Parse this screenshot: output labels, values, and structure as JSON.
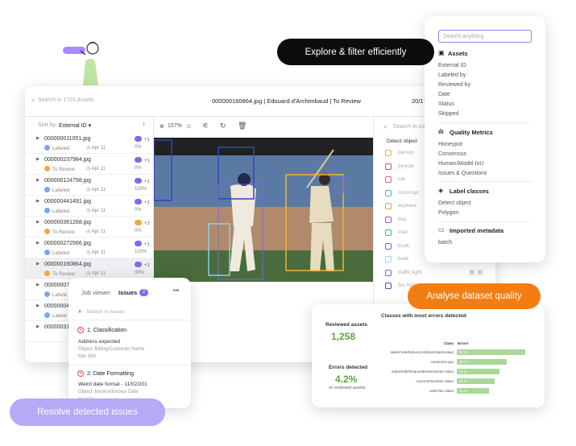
{
  "colors": {
    "accent": "#8a86f8",
    "orange": "#f27e13",
    "pill_dark": "#0d0d0d",
    "lavender": "#b7a9f5",
    "green": "#a9d897",
    "metric_green": "#5aa640"
  },
  "illustration": {
    "icon": "person-with-flag-illustration"
  },
  "pills": {
    "explore": "Explore & filter efficiently",
    "analyse": "Analyse dataset quality",
    "resolve": "Resolve detected issues"
  },
  "main": {
    "search_placeholder": "Search in 1701 Assets",
    "file_title": "000000160864.jpg | Edouard d'Archimbaud | To Review",
    "counter": "20/17(",
    "sort_label": "Sort by:",
    "sort_value": "External ID",
    "zoom": "157%",
    "assets": [
      {
        "name": "000000011051.jpg",
        "status": "Labeled",
        "date": "Apr 11",
        "pct": "0%",
        "tag": "+1"
      },
      {
        "name": "000000237984.jpg",
        "status": "To Review",
        "date": "Apr 11",
        "pct": "0%",
        "tag": "+1"
      },
      {
        "name": "000000124798.jpg",
        "status": "Labeled",
        "date": "Apr 11",
        "pct": "100%",
        "tag": "+1"
      },
      {
        "name": "000000441491.jpg",
        "status": "Labeled",
        "date": "Apr 11",
        "pct": "0%",
        "tag": "+1"
      },
      {
        "name": "000000361268.jpg",
        "status": "To Review",
        "date": "Apr 11",
        "pct": "0%",
        "tag": "+2"
      },
      {
        "name": "000000272566.jpg",
        "status": "Labeled",
        "date": "Apr 11",
        "pct": "100%",
        "tag": "+1"
      },
      {
        "name": "000000160864.jpg",
        "status": "To Review",
        "date": "Apr 11",
        "pct": "39%",
        "tag": "+1"
      },
      {
        "name": "00000007",
        "status": "Labele",
        "date": "",
        "pct": "",
        "tag": ""
      },
      {
        "name": "00000004",
        "status": "Labele",
        "date": "",
        "pct": "",
        "tag": ""
      },
      {
        "name": "00000031",
        "status": "",
        "date": "",
        "pct": "",
        "tag": ""
      }
    ],
    "right_search": "Search in co",
    "detect_label": "Detect object",
    "classes": [
      {
        "label": "person",
        "color": "#f2b233"
      },
      {
        "label": "bicycle",
        "color": "#e8474b"
      },
      {
        "label": "car",
        "color": "#e65aa0"
      },
      {
        "label": "motorcyc",
        "color": "#3fb8c4"
      },
      {
        "label": "airplane",
        "color": "#f39a3c"
      },
      {
        "label": "bus",
        "color": "#9a58e0"
      },
      {
        "label": "train",
        "color": "#36b0d8"
      },
      {
        "label": "truck",
        "color": "#7b5ee6"
      },
      {
        "label": "boat",
        "color": "#9ad0f0"
      },
      {
        "label": "traffic light",
        "color": "#7b5ee6"
      },
      {
        "label": "fire hydrant",
        "color": "#4b46c8"
      }
    ],
    "traffic_keys": [
      "D",
      "F"
    ],
    "hydrant_keys": [
      "D",
      "I"
    ]
  },
  "filter": {
    "search_placeholder": "Search anything",
    "assets_title": "Assets",
    "assets_items": [
      "External ID",
      "Labeled by",
      "Reviewed by",
      "Date",
      "Status",
      "Skipped"
    ],
    "quality_title": "Quality Metrics",
    "quality_items": [
      "Honeypot",
      "Consensus",
      "Human/Model IoU",
      "Issues & Questions"
    ],
    "label_title": "Label classes",
    "label_items": [
      "Detect object",
      "Polygon"
    ],
    "meta_title": "Imported metadata",
    "meta_items": [
      "batch"
    ]
  },
  "issues": {
    "tab_job": "Job viewer",
    "tab_issues": "Issues",
    "issues_count": "2",
    "more": "•••",
    "search_placeholder": "Search in issues",
    "items": [
      {
        "title": "1: Classification",
        "desc": "Address expected",
        "object": "Object: Billing/Customer Name",
        "who": "Mai Shh"
      },
      {
        "title": "2: Date Formatting",
        "desc": "Weird date format - 11/02/201",
        "object": "Object: Invoice/Invoice Date",
        "who": "Hipolito"
      }
    ]
  },
  "quality": {
    "reviewed_label": "Reviewed assets",
    "reviewed_value": "1,258",
    "errors_label": "Errors detected",
    "errors_value": "4.2%",
    "errors_sub": "of reviewed assets",
    "chart_title": "Classes with most errors detected",
    "col_class": "Class",
    "col_errors": "Errors"
  },
  "chart_data": {
    "type": "bar",
    "title": "Classes with most errors detected",
    "categories": [
      "salesOrderDeliveryAddressStatecvalue",
      "customerLogo",
      "salesOrderRequestDeliveryDate.Value",
      "customerNumber.Value",
      "salesTax.Value"
    ],
    "values": [
      38,
      28,
      24,
      21,
      18
    ],
    "labels": [
      "38 %",
      "28 %",
      "24 %",
      "21 %",
      "18 %"
    ],
    "xlabel": "Errors",
    "ylabel": "Class",
    "xlim": [
      0,
      40
    ]
  }
}
